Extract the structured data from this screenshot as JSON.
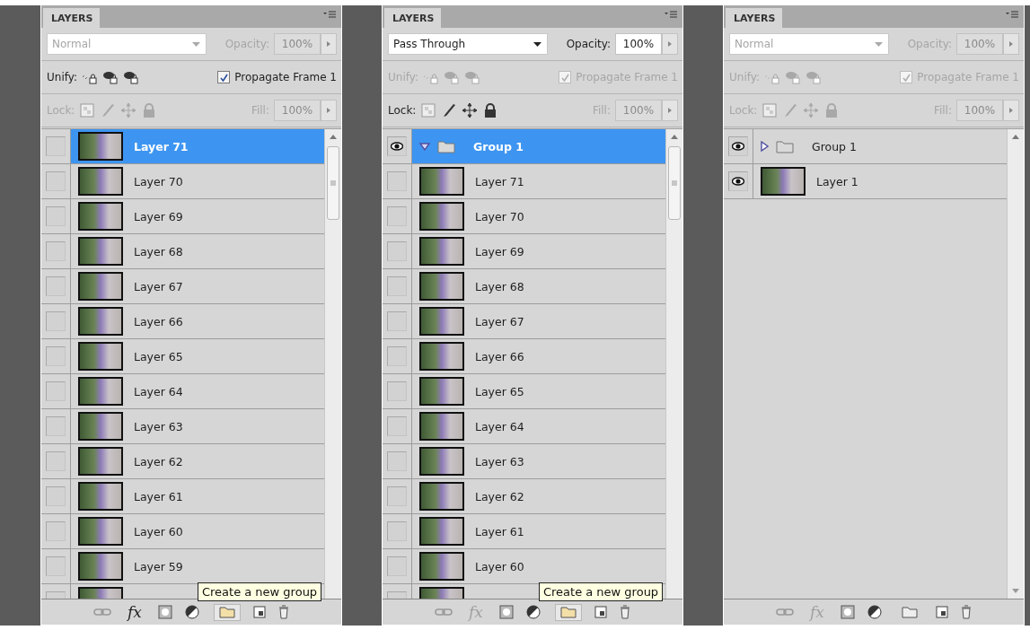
{
  "panels": [
    {
      "tab": "LAYERS",
      "blend": {
        "value": "Normal",
        "disabled": true
      },
      "opacity": {
        "label": "Opacity:",
        "value": "100%",
        "disabled": true
      },
      "unify": {
        "label": "Unify:",
        "disabled": false
      },
      "propagate": {
        "label": "Propagate Frame 1",
        "checked": true,
        "disabled": false
      },
      "lock": {
        "label": "Lock:",
        "disabled": true
      },
      "fill": {
        "label": "Fill:",
        "value": "100%",
        "disabled": true
      },
      "layers": [
        {
          "kind": "layer",
          "name": "Layer 71",
          "selected": true,
          "visible": false
        },
        {
          "kind": "layer",
          "name": "Layer 70",
          "selected": false,
          "visible": false
        },
        {
          "kind": "layer",
          "name": "Layer 69",
          "selected": false,
          "visible": false
        },
        {
          "kind": "layer",
          "name": "Layer 68",
          "selected": false,
          "visible": false
        },
        {
          "kind": "layer",
          "name": "Layer 67",
          "selected": false,
          "visible": false
        },
        {
          "kind": "layer",
          "name": "Layer 66",
          "selected": false,
          "visible": false
        },
        {
          "kind": "layer",
          "name": "Layer 65",
          "selected": false,
          "visible": false
        },
        {
          "kind": "layer",
          "name": "Layer 64",
          "selected": false,
          "visible": false
        },
        {
          "kind": "layer",
          "name": "Layer 63",
          "selected": false,
          "visible": false
        },
        {
          "kind": "layer",
          "name": "Layer 62",
          "selected": false,
          "visible": false
        },
        {
          "kind": "layer",
          "name": "Layer 61",
          "selected": false,
          "visible": false
        },
        {
          "kind": "layer",
          "name": "Layer 60",
          "selected": false,
          "visible": false
        },
        {
          "kind": "layer",
          "name": "Layer 59",
          "selected": false,
          "visible": false
        },
        {
          "kind": "layer",
          "selected": false,
          "visible": false
        }
      ],
      "footer": {
        "fx": "fx",
        "fx_disabled": false
      },
      "tooltip": "Create a new group"
    },
    {
      "tab": "LAYERS",
      "blend": {
        "value": "Pass Through",
        "disabled": false
      },
      "opacity": {
        "label": "Opacity:",
        "value": "100%",
        "disabled": false
      },
      "unify": {
        "label": "Unify:",
        "disabled": true
      },
      "propagate": {
        "label": "Propagate Frame 1",
        "checked": true,
        "disabled": true
      },
      "lock": {
        "label": "Lock:",
        "disabled": false
      },
      "fill": {
        "label": "Fill:",
        "value": "100%",
        "disabled": true
      },
      "layers": [
        {
          "kind": "group",
          "name": "Group 1",
          "selected": true,
          "visible": true,
          "expanded": true,
          "children": [
            {
              "kind": "layer",
              "name": "Layer 71",
              "selected": false,
              "visible": false
            },
            {
              "kind": "layer",
              "name": "Layer 70",
              "selected": false,
              "visible": false
            },
            {
              "kind": "layer",
              "name": "Layer 69",
              "selected": false,
              "visible": false
            },
            {
              "kind": "layer",
              "name": "Layer 68",
              "selected": false,
              "visible": false
            },
            {
              "kind": "layer",
              "name": "Layer 67",
              "selected": false,
              "visible": false
            },
            {
              "kind": "layer",
              "name": "Layer 66",
              "selected": false,
              "visible": false
            },
            {
              "kind": "layer",
              "name": "Layer 65",
              "selected": false,
              "visible": false
            },
            {
              "kind": "layer",
              "name": "Layer 64",
              "selected": false,
              "visible": false
            },
            {
              "kind": "layer",
              "name": "Layer 63",
              "selected": false,
              "visible": false
            },
            {
              "kind": "layer",
              "name": "Layer 62",
              "selected": false,
              "visible": false
            },
            {
              "kind": "layer",
              "name": "Layer 61",
              "selected": false,
              "visible": false
            },
            {
              "kind": "layer",
              "name": "Layer 60",
              "selected": false,
              "visible": false
            },
            {
              "kind": "layer",
              "selected": false,
              "visible": false
            }
          ]
        }
      ],
      "footer": {
        "fx": "fx",
        "fx_disabled": true
      },
      "tooltip": "Create a new group"
    },
    {
      "tab": "LAYERS",
      "blend": {
        "value": "Normal",
        "disabled": true
      },
      "opacity": {
        "label": "Opacity:",
        "value": "100%",
        "disabled": true
      },
      "unify": {
        "label": "Unify:",
        "disabled": true
      },
      "propagate": {
        "label": "Propagate Frame 1",
        "checked": true,
        "disabled": true
      },
      "lock": {
        "label": "Lock:",
        "disabled": true
      },
      "fill": {
        "label": "Fill:",
        "value": "100%",
        "disabled": true
      },
      "layers": [
        {
          "kind": "group",
          "name": "Group 1",
          "selected": false,
          "visible": true,
          "expanded": false
        },
        {
          "kind": "layer",
          "name": "Layer 1",
          "selected": false,
          "visible": true
        }
      ],
      "footer": {
        "fx": "fx",
        "fx_disabled": true
      }
    }
  ]
}
